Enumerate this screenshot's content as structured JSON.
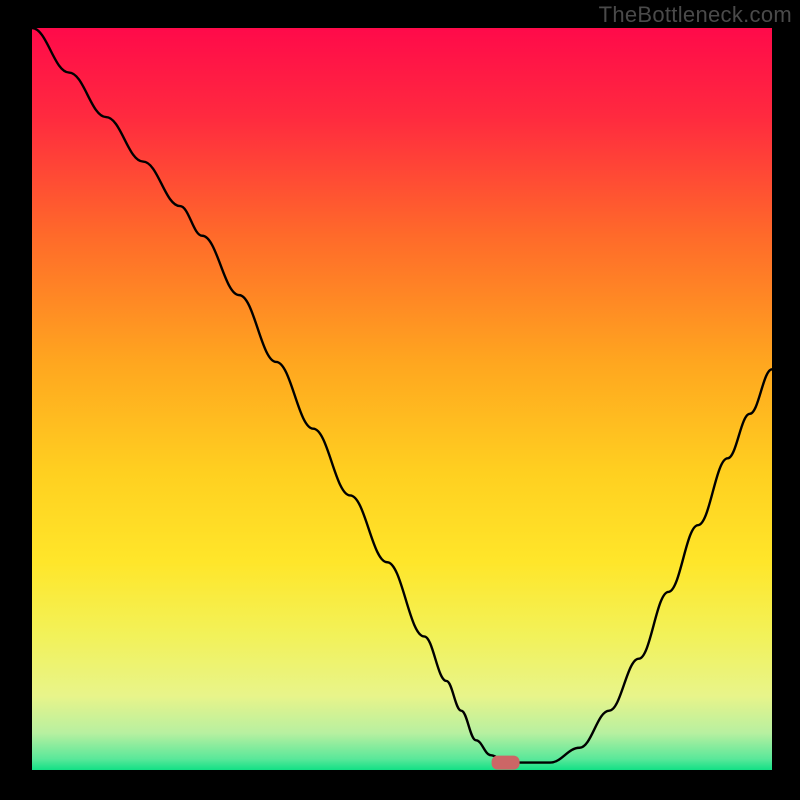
{
  "watermark": "TheBottleneck.com",
  "chart_data": {
    "type": "line",
    "title": "",
    "xlabel": "",
    "ylabel": "",
    "xlim": [
      0,
      100
    ],
    "ylim": [
      0,
      100
    ],
    "curve": {
      "x": [
        0,
        5,
        10,
        15,
        20,
        23,
        28,
        33,
        38,
        43,
        48,
        53,
        56,
        58,
        60,
        62,
        64,
        66,
        70,
        74,
        78,
        82,
        86,
        90,
        94,
        97,
        100
      ],
      "y": [
        100,
        94,
        88,
        82,
        76,
        72,
        64,
        55,
        46,
        37,
        28,
        18,
        12,
        8,
        4,
        2,
        1,
        1,
        1,
        3,
        8,
        15,
        24,
        33,
        42,
        48,
        54
      ]
    },
    "marker": {
      "x": 64,
      "y": 1
    },
    "gradient_stops": [
      {
        "pos": 0.0,
        "color": "#ff0a4a"
      },
      {
        "pos": 0.12,
        "color": "#ff2a3f"
      },
      {
        "pos": 0.28,
        "color": "#ff6a2a"
      },
      {
        "pos": 0.45,
        "color": "#ffa61f"
      },
      {
        "pos": 0.6,
        "color": "#ffd020"
      },
      {
        "pos": 0.72,
        "color": "#ffe62a"
      },
      {
        "pos": 0.82,
        "color": "#f2f25a"
      },
      {
        "pos": 0.9,
        "color": "#e8f48a"
      },
      {
        "pos": 0.95,
        "color": "#b8f0a0"
      },
      {
        "pos": 0.985,
        "color": "#5ae89a"
      },
      {
        "pos": 1.0,
        "color": "#12e085"
      }
    ]
  }
}
